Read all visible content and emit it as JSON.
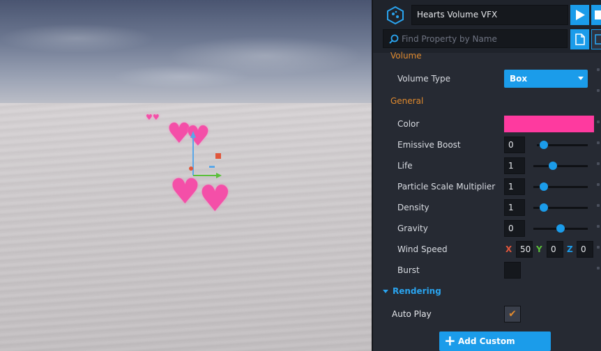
{
  "header": {
    "object_name": "Hearts Volume VFX",
    "search_placeholder": "Find Property by Name"
  },
  "sections": {
    "volume": "Volume",
    "general": "General",
    "rendering": "Rendering"
  },
  "properties": {
    "volume_type": {
      "label": "Volume Type",
      "value": "Box"
    },
    "color": {
      "label": "Color",
      "value": "#fe3a9f"
    },
    "emissive_boost": {
      "label": "Emissive Boost",
      "value": "0",
      "slider": 0.07
    },
    "life": {
      "label": "Life",
      "value": "1",
      "slider": 0.33
    },
    "particle_scale": {
      "label": "Particle Scale Multiplier",
      "value": "1",
      "slider": 0.14
    },
    "density": {
      "label": "Density",
      "value": "1",
      "slider": 0.14
    },
    "gravity": {
      "label": "Gravity",
      "value": "0",
      "slider": 0.5
    },
    "wind_speed": {
      "label": "Wind Speed",
      "x_label": "X",
      "x": "50",
      "y_label": "Y",
      "y": "0",
      "z_label": "Z",
      "z": "0"
    },
    "burst": {
      "label": "Burst",
      "checked": false
    },
    "auto_play": {
      "label": "Auto Play",
      "checked": true
    }
  },
  "buttons": {
    "add_custom_property": "Add Custom Property"
  },
  "colors": {
    "accent": "#1b9cea",
    "section_orange": "#e08a2e",
    "heart_pink": "#f44fa8",
    "axis_x": "#e0563b",
    "axis_y": "#5bbf3a",
    "axis_z": "#1b9cea"
  }
}
